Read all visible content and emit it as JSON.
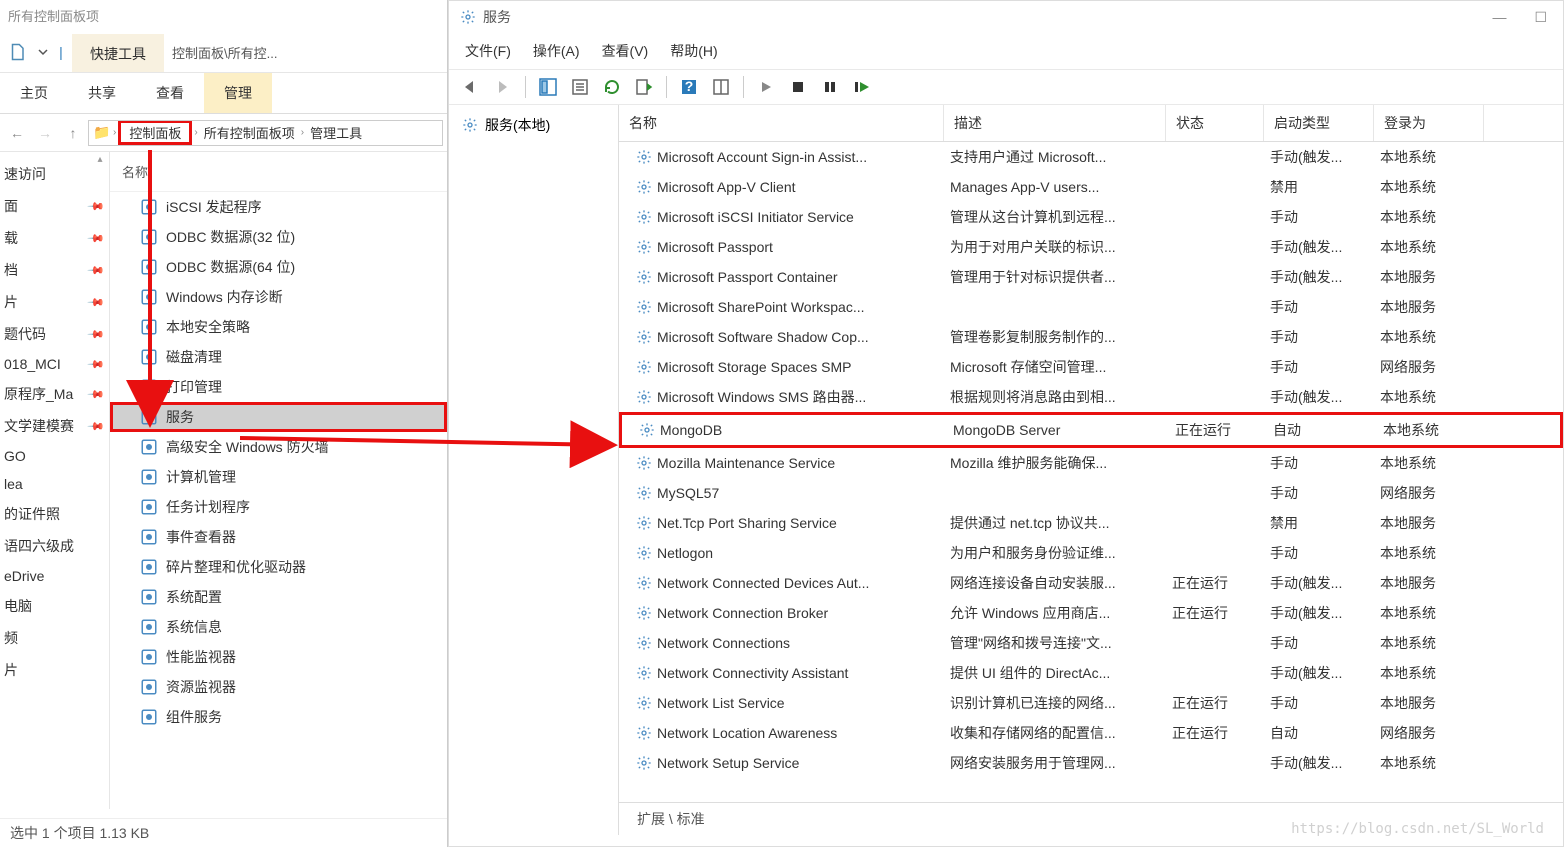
{
  "explorer": {
    "title": "所有控制面板项",
    "ribbon_tool_tab": "快捷工具",
    "breadcrumb_right": "控制面板\\所有控...",
    "subtabs": [
      "主页",
      "共享",
      "查看",
      "管理"
    ],
    "address": {
      "seg1": "控制面板",
      "seg2": "所有控制面板项",
      "seg3": "管理工具"
    },
    "nav_group": "速访问",
    "nav_items": [
      {
        "label": "面",
        "pinned": true
      },
      {
        "label": "载",
        "pinned": true
      },
      {
        "label": "档",
        "pinned": true
      },
      {
        "label": "片",
        "pinned": true
      },
      {
        "label": "题代码",
        "pinned": true
      },
      {
        "label": "018_MCI",
        "pinned": true
      },
      {
        "label": "原程序_Ma",
        "pinned": true
      },
      {
        "label": "文学建模赛",
        "pinned": true
      },
      {
        "label": "GO",
        "pinned": false
      },
      {
        "label": "lea",
        "pinned": false
      },
      {
        "label": "的证件照",
        "pinned": false
      },
      {
        "label": "语四六级成",
        "pinned": false
      },
      {
        "label": "eDrive",
        "pinned": false
      },
      {
        "label": "电脑",
        "pinned": false
      },
      {
        "label": "频",
        "pinned": false
      },
      {
        "label": "片",
        "pinned": false
      }
    ],
    "col_header": "名称",
    "items": [
      {
        "label": "iSCSI 发起程序"
      },
      {
        "label": "ODBC 数据源(32 位)"
      },
      {
        "label": "ODBC 数据源(64 位)"
      },
      {
        "label": "Windows 内存诊断"
      },
      {
        "label": "本地安全策略"
      },
      {
        "label": "磁盘清理"
      },
      {
        "label": "打印管理"
      },
      {
        "label": "服务",
        "selected": true
      },
      {
        "label": "高级安全 Windows 防火墙"
      },
      {
        "label": "计算机管理"
      },
      {
        "label": "任务计划程序"
      },
      {
        "label": "事件查看器"
      },
      {
        "label": "碎片整理和优化驱动器"
      },
      {
        "label": "系统配置"
      },
      {
        "label": "系统信息"
      },
      {
        "label": "性能监视器"
      },
      {
        "label": "资源监视器"
      },
      {
        "label": "组件服务"
      }
    ],
    "status": "选中 1 个项目  1.13 KB"
  },
  "services": {
    "title": "服务",
    "menus": [
      "文件(F)",
      "操作(A)",
      "查看(V)",
      "帮助(H)"
    ],
    "left_pane_label": "服务(本地)",
    "columns": {
      "name": "名称",
      "desc": "描述",
      "state": "状态",
      "start": "启动类型",
      "logon": "登录为"
    },
    "bottom_tabs": "扩展 \\ 标准",
    "rows": [
      {
        "name": "Microsoft Account Sign-in Assist...",
        "desc": "支持用户通过 Microsoft...",
        "state": "",
        "start": "手动(触发...",
        "logon": "本地系统"
      },
      {
        "name": "Microsoft App-V Client",
        "desc": "Manages App-V users...",
        "state": "",
        "start": "禁用",
        "logon": "本地系统"
      },
      {
        "name": "Microsoft iSCSI Initiator Service",
        "desc": "管理从这台计算机到远程...",
        "state": "",
        "start": "手动",
        "logon": "本地系统"
      },
      {
        "name": "Microsoft Passport",
        "desc": "为用于对用户关联的标识...",
        "state": "",
        "start": "手动(触发...",
        "logon": "本地系统"
      },
      {
        "name": "Microsoft Passport Container",
        "desc": "管理用于针对标识提供者...",
        "state": "",
        "start": "手动(触发...",
        "logon": "本地服务"
      },
      {
        "name": "Microsoft SharePoint Workspac...",
        "desc": "",
        "state": "",
        "start": "手动",
        "logon": "本地服务"
      },
      {
        "name": "Microsoft Software Shadow Cop...",
        "desc": "管理卷影复制服务制作的...",
        "state": "",
        "start": "手动",
        "logon": "本地系统"
      },
      {
        "name": "Microsoft Storage Spaces SMP",
        "desc": "Microsoft 存储空间管理...",
        "state": "",
        "start": "手动",
        "logon": "网络服务"
      },
      {
        "name": "Microsoft Windows SMS 路由器...",
        "desc": "根据规则将消息路由到相...",
        "state": "",
        "start": "手动(触发...",
        "logon": "本地系统"
      },
      {
        "name": "MongoDB",
        "desc": "MongoDB Server",
        "state": "正在运行",
        "start": "自动",
        "logon": "本地系统",
        "hl": true
      },
      {
        "name": "Mozilla Maintenance Service",
        "desc": "Mozilla 维护服务能确保...",
        "state": "",
        "start": "手动",
        "logon": "本地系统"
      },
      {
        "name": "MySQL57",
        "desc": "",
        "state": "",
        "start": "手动",
        "logon": "网络服务"
      },
      {
        "name": "Net.Tcp Port Sharing Service",
        "desc": "提供通过 net.tcp 协议共...",
        "state": "",
        "start": "禁用",
        "logon": "本地服务"
      },
      {
        "name": "Netlogon",
        "desc": "为用户和服务身份验证维...",
        "state": "",
        "start": "手动",
        "logon": "本地系统"
      },
      {
        "name": "Network Connected Devices Aut...",
        "desc": "网络连接设备自动安装服...",
        "state": "正在运行",
        "start": "手动(触发...",
        "logon": "本地服务"
      },
      {
        "name": "Network Connection Broker",
        "desc": "允许 Windows 应用商店...",
        "state": "正在运行",
        "start": "手动(触发...",
        "logon": "本地系统"
      },
      {
        "name": "Network Connections",
        "desc": "管理\"网络和拨号连接\"文...",
        "state": "",
        "start": "手动",
        "logon": "本地系统"
      },
      {
        "name": "Network Connectivity Assistant",
        "desc": "提供 UI 组件的 DirectAc...",
        "state": "",
        "start": "手动(触发...",
        "logon": "本地系统"
      },
      {
        "name": "Network List Service",
        "desc": "识别计算机已连接的网络...",
        "state": "正在运行",
        "start": "手动",
        "logon": "本地服务"
      },
      {
        "name": "Network Location Awareness",
        "desc": "收集和存储网络的配置信...",
        "state": "正在运行",
        "start": "自动",
        "logon": "网络服务"
      },
      {
        "name": "Network Setup Service",
        "desc": "网络安装服务用于管理网...",
        "state": "",
        "start": "手动(触发...",
        "logon": "本地系统"
      }
    ]
  }
}
